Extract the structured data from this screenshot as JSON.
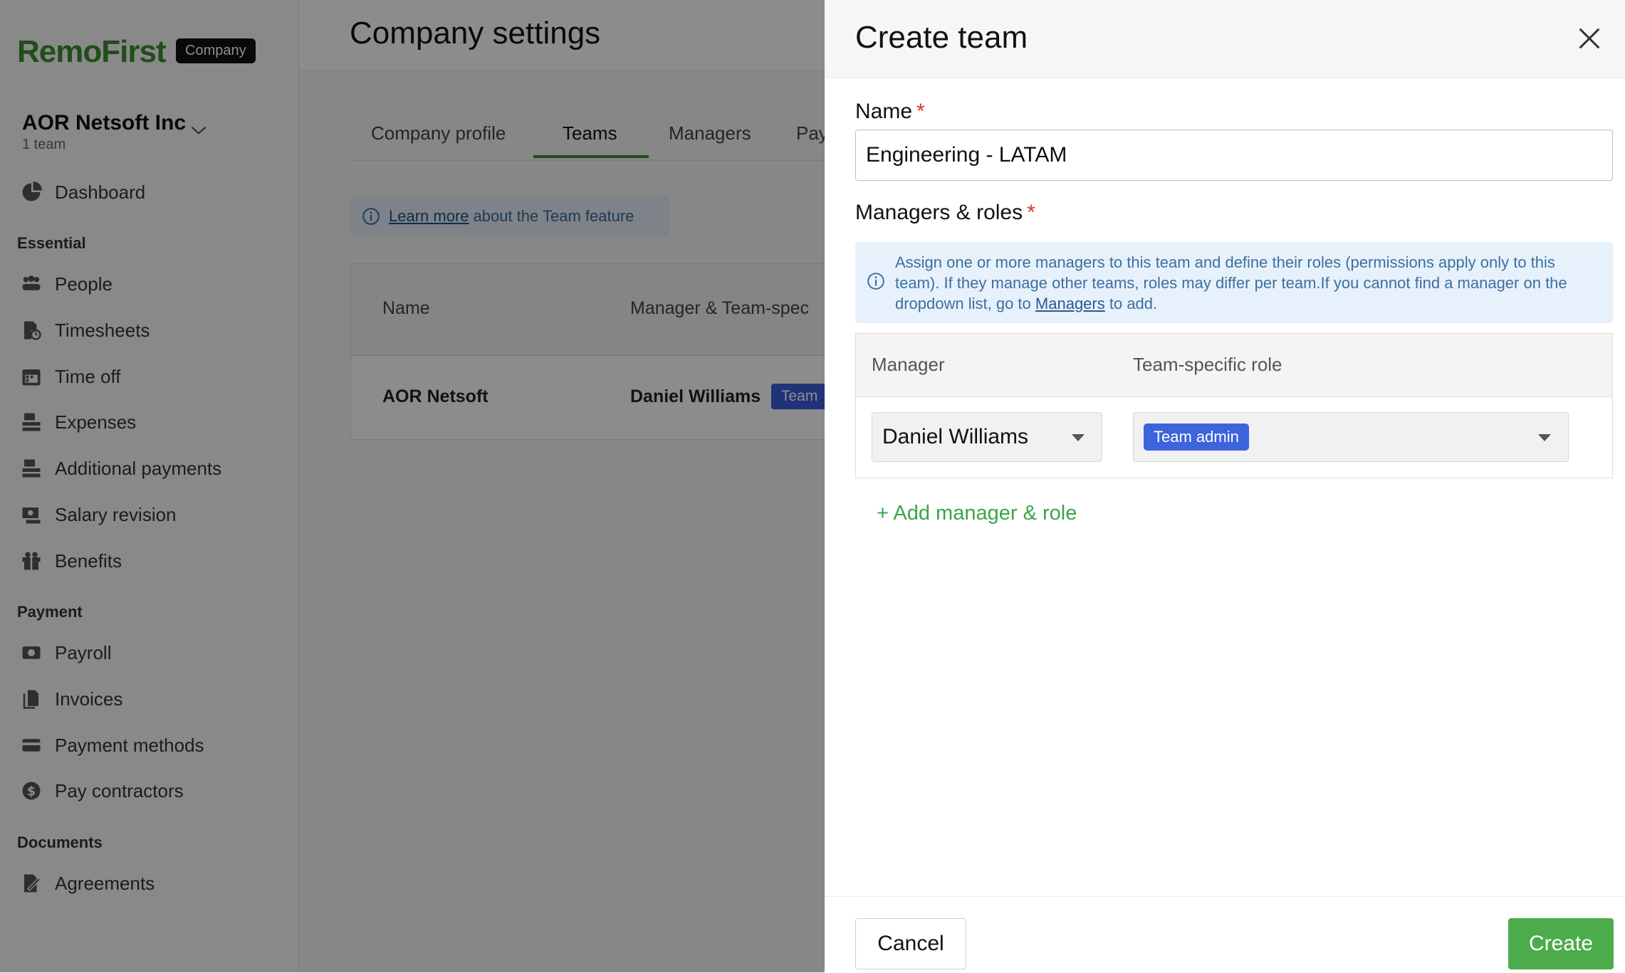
{
  "brand": {
    "logo_text": "RemoFirst",
    "badge": "Company"
  },
  "org": {
    "name": "AOR Netsoft Inc",
    "sub": "1 team"
  },
  "sidebar": {
    "dashboard": "Dashboard",
    "sections": {
      "essential": "Essential",
      "payment": "Payment",
      "documents": "Documents"
    },
    "essential_items": [
      "People",
      "Timesheets",
      "Time off",
      "Expenses",
      "Additional payments",
      "Salary revision",
      "Benefits"
    ],
    "payment_items": [
      "Payroll",
      "Invoices",
      "Payment methods",
      "Pay contractors"
    ],
    "documents_items": [
      "Agreements"
    ]
  },
  "page": {
    "title": "Company settings",
    "tabs": [
      "Company profile",
      "Teams",
      "Managers",
      "Pay"
    ],
    "active_tab": "Teams",
    "info": {
      "link": "Learn more",
      "text": "about the Team feature"
    },
    "table": {
      "headers": [
        "Name",
        "Manager & Team-spec"
      ],
      "rows": [
        {
          "name": "AOR Netsoft",
          "manager": "Daniel Williams",
          "badge": "Team"
        }
      ]
    }
  },
  "drawer": {
    "title": "Create team",
    "name_label": "Name",
    "required_mark": "*",
    "name_value": "Engineering - LATAM",
    "managers_label": "Managers & roles",
    "info": {
      "text_before": "Assign one or more managers to this team and define their roles (permissions apply only to this team). If they manage other teams, roles may differ per team.If you cannot find a manager on the dropdown list, go to ",
      "link": "Managers",
      "text_after": " to add."
    },
    "table": {
      "header_manager": "Manager",
      "header_role": "Team-specific role",
      "rows": [
        {
          "manager": "Daniel Williams",
          "role": "Team admin"
        }
      ]
    },
    "add_link": "+ Add manager & role",
    "cancel": "Cancel",
    "create": "Create"
  },
  "colors": {
    "brand_green": "#3c8d32",
    "create_button": "#4cab4b",
    "required": "#d9342b",
    "role_chip": "#3d63dd"
  }
}
